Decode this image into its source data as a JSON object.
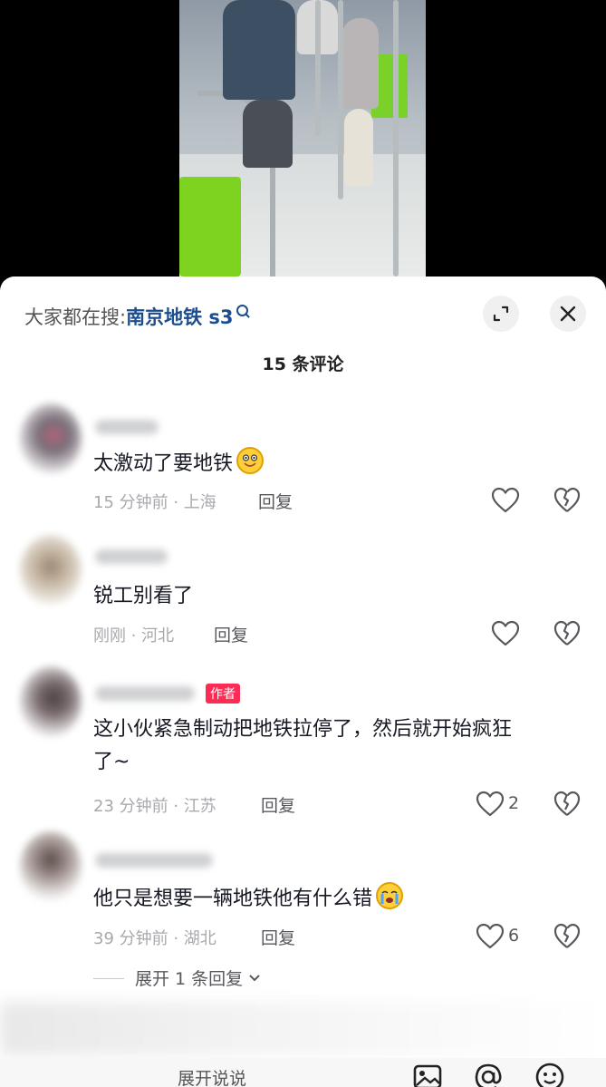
{
  "header": {
    "hot_search_label": "大家都在搜:",
    "hot_search_term": "南京地铁 s3",
    "comment_count": "15 条评论"
  },
  "comments": [
    {
      "text": "太激动了要地铁",
      "emoji": "smile-emoji",
      "time": "15 分钟前 · 上海",
      "reply": "回复",
      "likes": ""
    },
    {
      "text": "锐工别看了",
      "time": "刚刚 · 河北",
      "reply": "回复",
      "likes": ""
    },
    {
      "author_tag": "作者",
      "text_line1": "这小伙紧急制动把地铁拉停了，然后就开始疯狂",
      "text_line2": "了~",
      "time": "23 分钟前 · 江苏",
      "reply": "回复",
      "likes": "2"
    },
    {
      "text": "他只是想要一辆地铁他有什么错",
      "emoji": "crying-emoji",
      "time": "39 分钟前 · 湖北",
      "reply": "回复",
      "likes": "6"
    }
  ],
  "expand_replies": "展开 1 条回复",
  "input_placeholder": "展开说说",
  "colors": {
    "accent": "#fe2c55",
    "link": "#1b4d8f",
    "seat_green": "#7ed321"
  }
}
